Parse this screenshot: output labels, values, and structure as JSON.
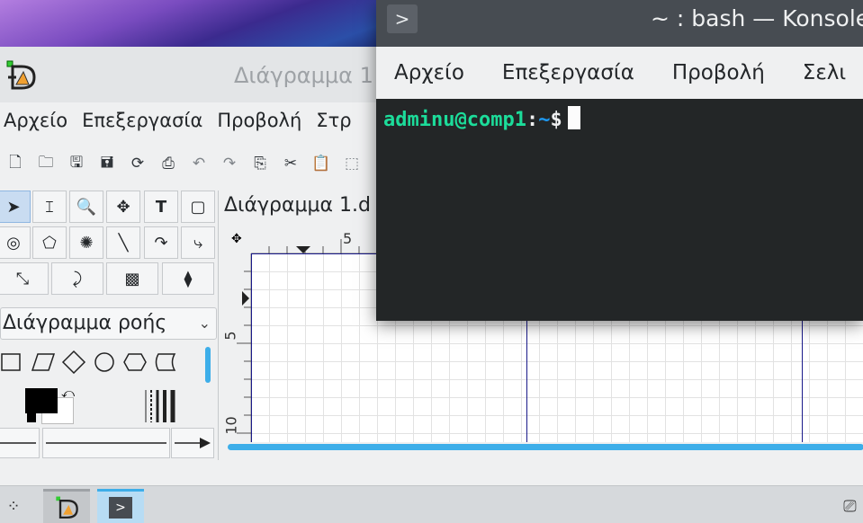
{
  "dia": {
    "title": "Διάγραμμα 1",
    "menu": [
      "Αρχείο",
      "Επεξεργασία",
      "Προβολή",
      "Στρ"
    ],
    "sheet_name": "Διάγραμμα ροής",
    "tab_label": "Διάγραμμα 1.d",
    "ruler": {
      "h_label": "5",
      "v_label_1": "5",
      "v_label_2": "10"
    },
    "toolbar_icons": [
      "new-file-icon",
      "open-folder-icon",
      "save-icon",
      "save-as-icon",
      "reload-icon",
      "print-icon",
      "undo-icon",
      "redo-icon",
      "copy-icon",
      "cut-icon",
      "paste-icon",
      "zoom-fit-icon"
    ],
    "colors": {
      "foreground": "#000000",
      "background": "#ffffff"
    }
  },
  "konsole": {
    "title": "~ : bash — Konsole",
    "menu": [
      "Αρχείο",
      "Επεξεργασία",
      "Προβολή",
      "Σελι"
    ],
    "prompt_user": "adminu@comp1",
    "prompt_colon": ":",
    "prompt_path": "~",
    "prompt_sign": "$"
  },
  "taskbar": {
    "items": [
      "launcher-icon",
      "dia-task",
      "konsole-task",
      "tray-icon"
    ]
  }
}
